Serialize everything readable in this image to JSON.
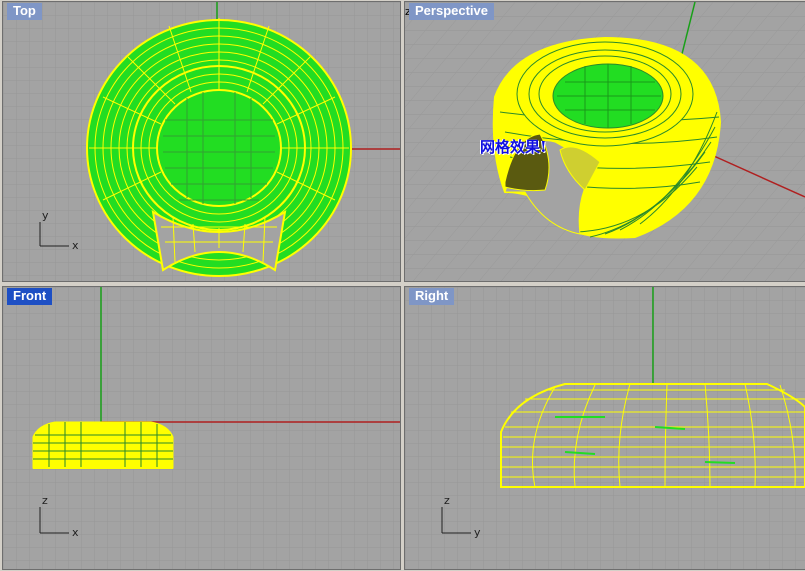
{
  "viewports": {
    "top": {
      "title": "Top"
    },
    "perspective": {
      "title": "Perspective"
    },
    "front": {
      "title": "Front"
    },
    "right": {
      "title": "Right"
    }
  },
  "axes": {
    "x": "x",
    "y": "y",
    "z": "z"
  },
  "annotation": {
    "text": "网格效果!"
  },
  "colors": {
    "viewport_bg": "#a3a3a3",
    "grid": "#999999",
    "grid_major": "#8c8c8c",
    "wire": "#ffff00",
    "surface": "#22dd22",
    "x_axis": "#b02020",
    "y_axis": "#18a018",
    "active_title": "#1d4fc4",
    "inactive_title": "#7f96c6"
  }
}
